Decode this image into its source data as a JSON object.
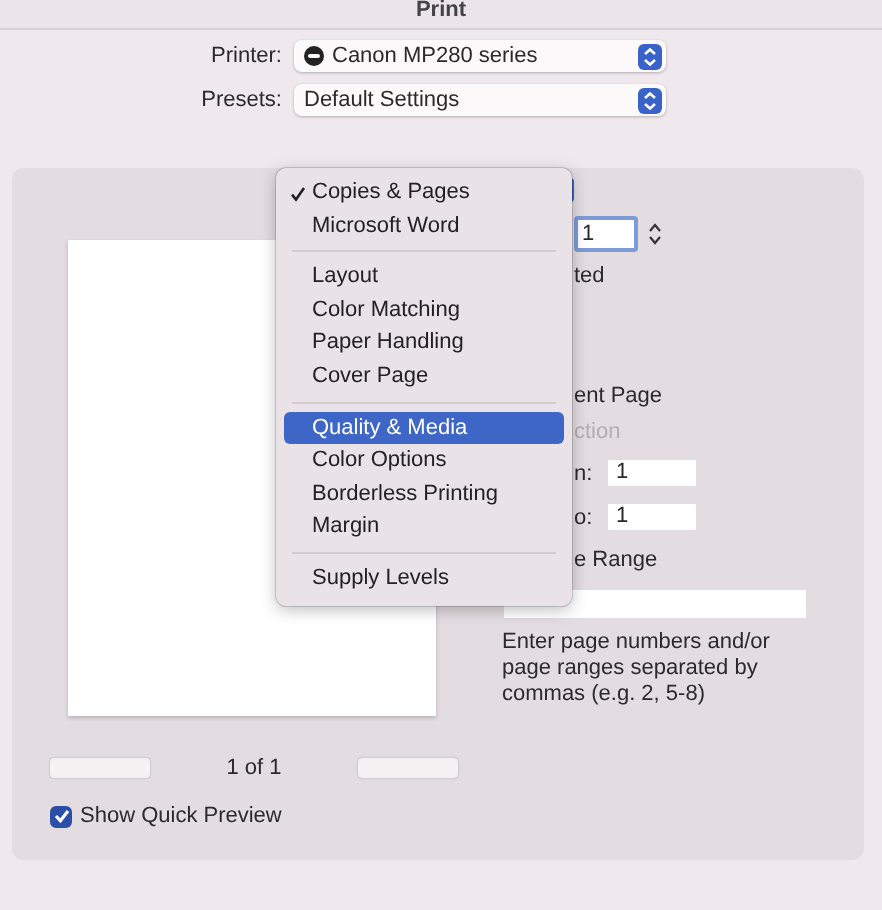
{
  "window": {
    "title": "Print"
  },
  "printer": {
    "label": "Printer:",
    "value": "Canon MP280 series"
  },
  "presets": {
    "label": "Presets:",
    "value": "Default Settings"
  },
  "menu": {
    "groups": [
      [
        {
          "label": "Copies & Pages",
          "checked": true,
          "selected": false
        },
        {
          "label": "Microsoft Word",
          "checked": false,
          "selected": false
        }
      ],
      [
        {
          "label": "Layout",
          "checked": false,
          "selected": false
        },
        {
          "label": "Color Matching",
          "checked": false,
          "selected": false
        },
        {
          "label": "Paper Handling",
          "checked": false,
          "selected": false
        },
        {
          "label": "Cover Page",
          "checked": false,
          "selected": false
        }
      ],
      [
        {
          "label": "Quality & Media",
          "checked": false,
          "selected": true
        },
        {
          "label": "Color Options",
          "checked": false,
          "selected": false
        },
        {
          "label": "Borderless Printing",
          "checked": false,
          "selected": false
        },
        {
          "label": "Margin",
          "checked": false,
          "selected": false
        }
      ],
      [
        {
          "label": "Supply Levels",
          "checked": false,
          "selected": false
        }
      ]
    ]
  },
  "pages": {
    "copies_value": "1",
    "collated_label": "ted",
    "current_page_label": "ent Page",
    "selection_label": {
      "text": "ction",
      "disabled": true
    },
    "from": {
      "label": "n:",
      "value": "1"
    },
    "to": {
      "label": "o:",
      "value": "1"
    },
    "range_label": "e Range",
    "hint": "Enter page numbers and/or page ranges separated by commas (e.g. 2, 5-8)"
  },
  "preview": {
    "page_label": "1 of 1"
  },
  "quick_preview": {
    "label": "Show Quick Preview",
    "checked": true
  }
}
